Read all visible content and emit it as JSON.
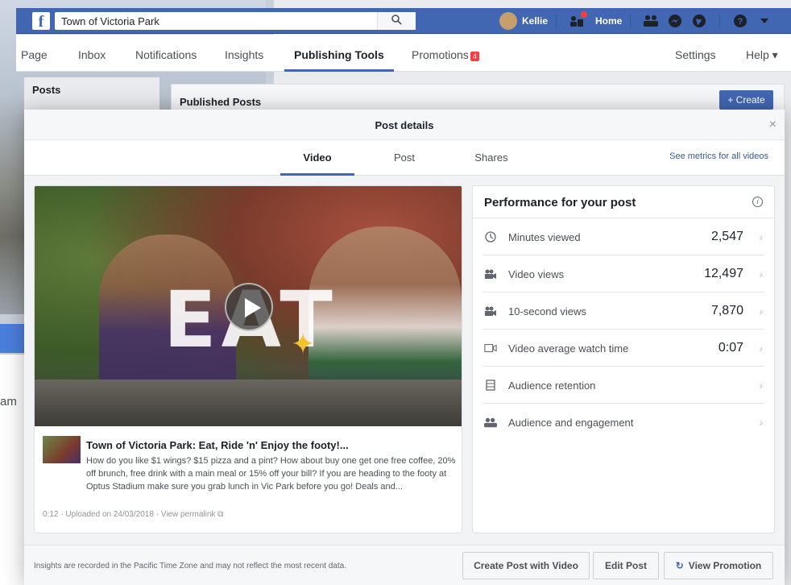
{
  "topbar": {
    "search_value": "Town of Victoria Park",
    "user_name": "Kellie",
    "home_label": "Home"
  },
  "page_nav": {
    "items": [
      "Page",
      "Inbox",
      "Notifications",
      "Insights",
      "Publishing Tools",
      "Promotions"
    ],
    "promotions_badge": "4",
    "settings_label": "Settings",
    "help_label": "Help ▾"
  },
  "background": {
    "posts_heading": "Posts",
    "published_posts_heading": "Published Posts",
    "create_label": "+ Create",
    "cut_text": "am"
  },
  "modal": {
    "title": "Post details",
    "close": "×",
    "tabs": [
      "Video",
      "Post",
      "Shares"
    ],
    "see_metrics_link": "See metrics for all videos",
    "post": {
      "title": "Town of Victoria Park: Eat, Ride 'n' Enjoy the footy!...",
      "description": "How do you like $1 wings? $15 pizza and a pint? How about buy one get one free coffee, 20% off brunch, free drink with a main meal or 15% off your bill? If you are heading to the footy at Optus Stadium make sure you grab lunch in Vic Park before you go! Deals and...",
      "meta": "0:12 · Uploaded on 24/03/2018 · View permalink ⧉",
      "video_overlay_text": "EAT"
    },
    "performance": {
      "heading": "Performance for your post",
      "info_icon": "i",
      "metrics": [
        {
          "icon": "clock-icon",
          "label": "Minutes viewed",
          "value": "2,547"
        },
        {
          "icon": "video-views-icon",
          "label": "Video views",
          "value": "12,497"
        },
        {
          "icon": "ten-second-views-icon",
          "label": "10-second views",
          "value": "7,870"
        },
        {
          "icon": "watch-time-icon",
          "label": "Video average watch time",
          "value": "0:07"
        },
        {
          "icon": "film-icon",
          "label": "Audience retention",
          "value": ""
        },
        {
          "icon": "people-icon",
          "label": "Audience and engagement",
          "value": ""
        }
      ]
    },
    "footer": {
      "note": "Insights are recorded in the Pacific Time Zone and may not reflect the most recent data.",
      "create_post_with_video": "Create Post with Video",
      "edit_post": "Edit Post",
      "view_promotion": "View Promotion"
    }
  }
}
